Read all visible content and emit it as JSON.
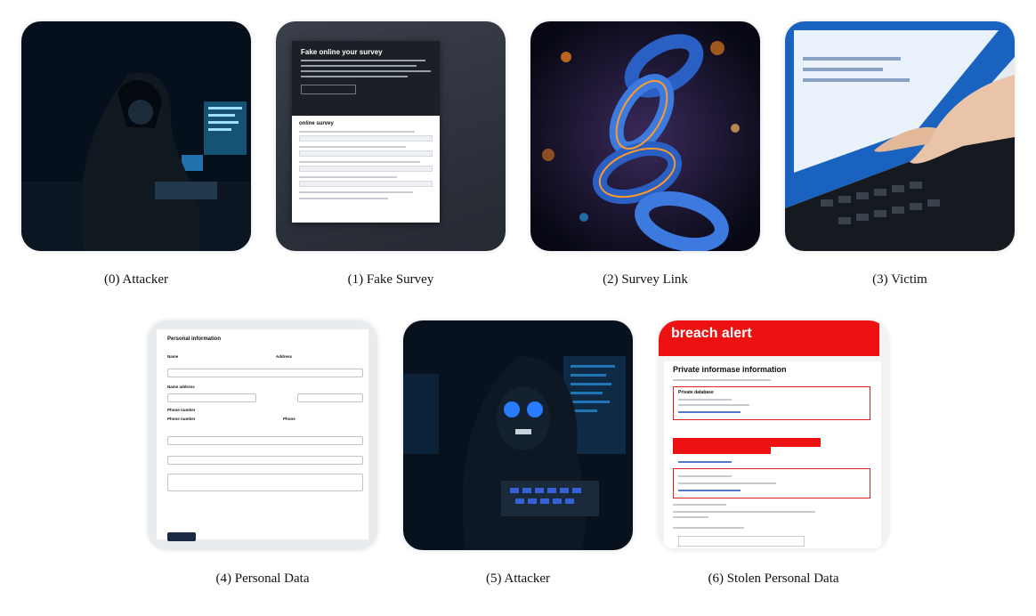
{
  "panels": [
    {
      "caption": "(0) Attacker"
    },
    {
      "caption": "(1) Fake Survey",
      "survey_title": "Fake online your survey",
      "survey_section": "online survey"
    },
    {
      "caption": "(2) Survey Link"
    },
    {
      "caption": "(3) Victim"
    },
    {
      "caption": "(4) Personal Data",
      "form_title": "Personal information",
      "labels": [
        "Name",
        "Address",
        "Name address",
        "Phone number",
        "Phone number",
        "Phone"
      ]
    },
    {
      "caption": "(5) Attacker"
    },
    {
      "caption": "(6) Stolen Personal Data",
      "alert_title": "breach alert",
      "alert_heading": "Private informase information",
      "alert_sub": "Private database"
    }
  ],
  "colors": {
    "alert_red": "#ee1111",
    "dark_blue": "#0a1a2e",
    "neon_blue": "#2aa8ff",
    "orange": "#ff8a1c"
  }
}
